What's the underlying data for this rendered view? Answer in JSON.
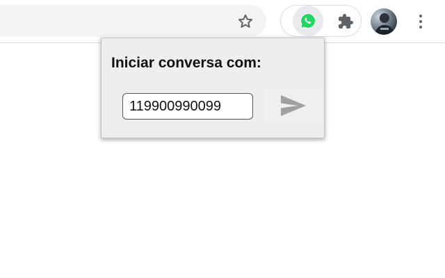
{
  "toolbar": {
    "icons": {
      "bookmark": "star-outline",
      "extension": "whatsapp",
      "extensions_menu": "puzzle-piece",
      "profile": "avatar",
      "chrome_menu": "three-dots-vertical"
    }
  },
  "popup": {
    "title": "Iniciar conversa com:",
    "phone_value": "119900990099",
    "send_icon": "send-arrow"
  },
  "colors": {
    "whatsapp_green": "#25d366",
    "popup_bg": "#eeeeee",
    "send_icon": "#a0a0a0"
  }
}
